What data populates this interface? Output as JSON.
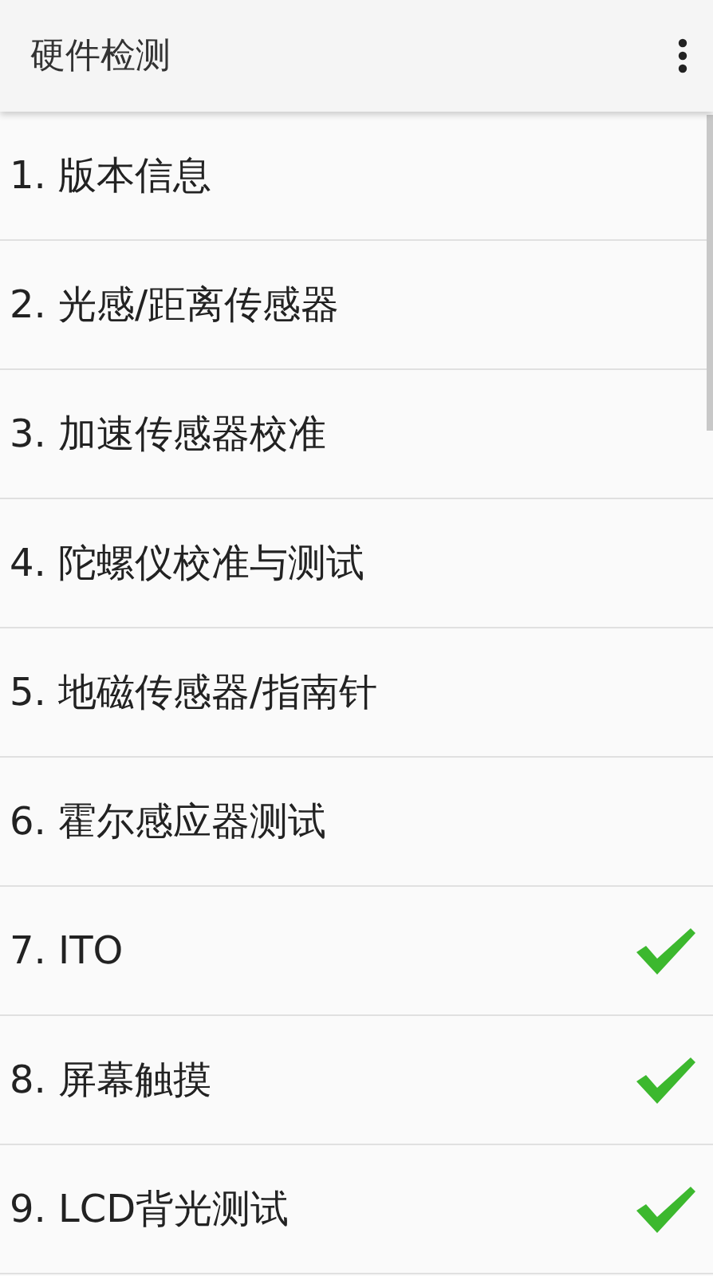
{
  "app_bar": {
    "title": "硬件检测"
  },
  "items": [
    {
      "label": "1. 版本信息",
      "passed": false
    },
    {
      "label": "2. 光感/距离传感器",
      "passed": false
    },
    {
      "label": "3. 加速传感器校准",
      "passed": false
    },
    {
      "label": "4. 陀螺仪校准与测试",
      "passed": false
    },
    {
      "label": "5. 地磁传感器/指南针",
      "passed": false
    },
    {
      "label": "6. 霍尔感应器测试",
      "passed": false
    },
    {
      "label": "7. ITO",
      "passed": true
    },
    {
      "label": "8. 屏幕触摸",
      "passed": true
    },
    {
      "label": "9. LCD背光测试",
      "passed": true
    }
  ]
}
